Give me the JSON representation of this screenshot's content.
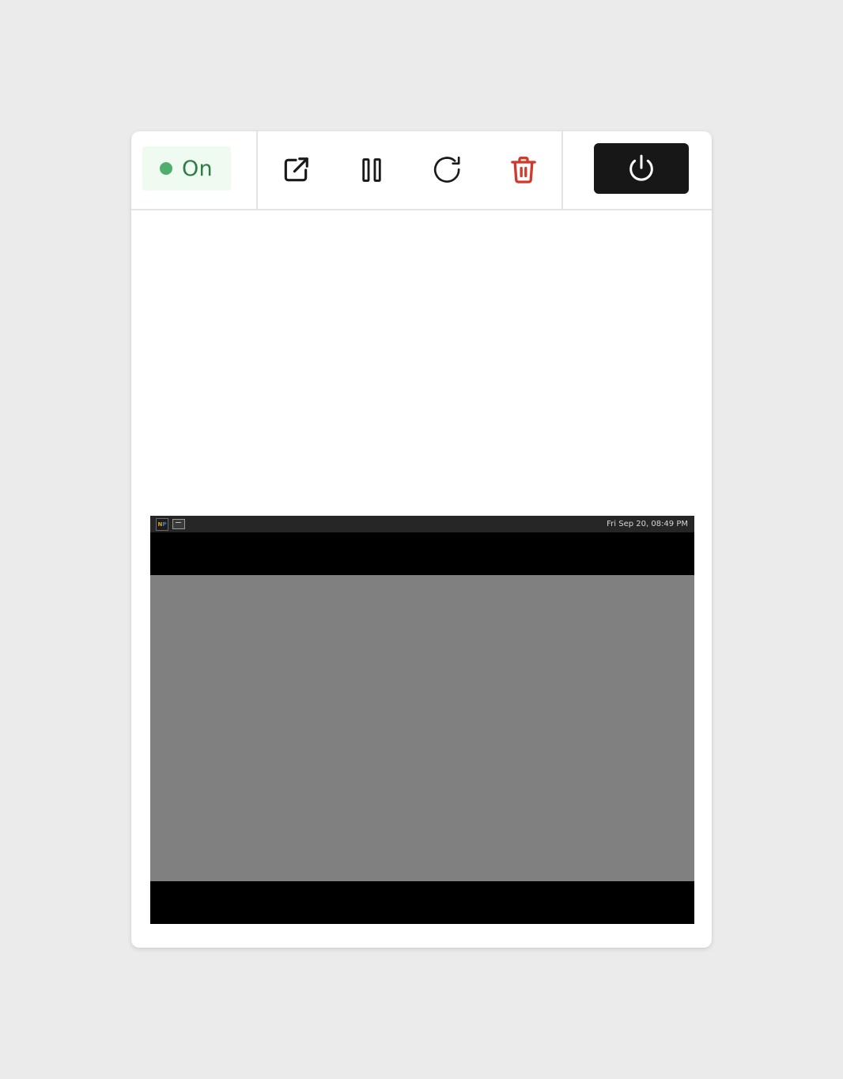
{
  "status": {
    "label": "On",
    "color": "#4fae6c",
    "text_color": "#2e7d46",
    "background": "#effaf1"
  },
  "actions": [
    {
      "name": "open-external",
      "icon": "external-link-icon",
      "color": "#1a1a1a"
    },
    {
      "name": "pause",
      "icon": "pause-icon",
      "color": "#1a1a1a"
    },
    {
      "name": "restart",
      "icon": "refresh-icon",
      "color": "#1a1a1a"
    },
    {
      "name": "delete",
      "icon": "trash-icon",
      "color": "#d0392b"
    }
  ],
  "power_button": {
    "icon": "power-icon",
    "background": "#171717"
  },
  "remote_screen": {
    "taskbar": {
      "apps": [
        {
          "icon": "app-launcher-icon",
          "label": "NP"
        },
        {
          "icon": "terminal-icon"
        }
      ],
      "clock": "Fri Sep 20, 08:49 PM"
    },
    "desktop_color": "#808080"
  }
}
